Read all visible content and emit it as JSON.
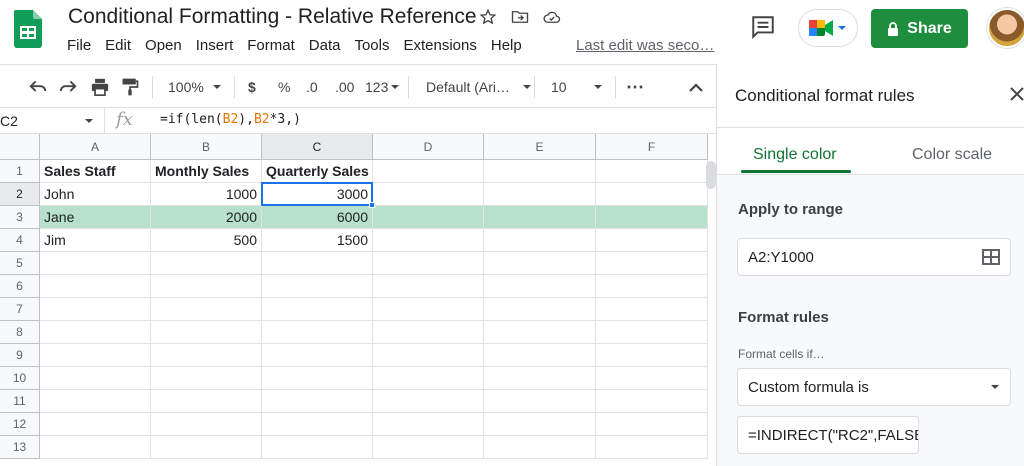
{
  "header": {
    "title": "Conditional Formatting - Relative Reference",
    "menu": [
      "File",
      "Edit",
      "Open",
      "Insert",
      "Format",
      "Data",
      "Tools",
      "Extensions",
      "Help"
    ],
    "last_edit": "Last edit was seco…",
    "share_label": "Share"
  },
  "toolbar": {
    "zoom": "100%",
    "currency": "$",
    "percent": "%",
    "dec_decrease": ".0",
    "dec_increase": ".00",
    "more_formats": "123",
    "font": "Default (Ari…",
    "font_size": "10",
    "more": "⋯"
  },
  "formula_bar": {
    "cell_ref": "C2",
    "fx": "fx",
    "formula_parts": [
      "=if(len(",
      "B2",
      "),",
      "B2",
      "*3,)"
    ]
  },
  "grid": {
    "columns": [
      "A",
      "B",
      "C",
      "D",
      "E",
      "F"
    ],
    "rows": [
      "1",
      "2",
      "3",
      "4",
      "5",
      "6",
      "7",
      "8",
      "9",
      "10",
      "11",
      "12",
      "13"
    ],
    "cells": [
      [
        "Sales Staff",
        "Monthly Sales",
        "Quarterly Sales",
        "",
        "",
        ""
      ],
      [
        "John",
        "1000",
        "3000",
        "",
        "",
        ""
      ],
      [
        "Jane",
        "2000",
        "6000",
        "",
        "",
        ""
      ],
      [
        "Jim",
        "500",
        "1500",
        "",
        "",
        ""
      ]
    ],
    "highlight_color": "#b7e1cd",
    "selection_color": "#1a73e8"
  },
  "panel": {
    "title": "Conditional format rules",
    "tab_single": "Single color",
    "tab_scale": "Color scale",
    "apply_label": "Apply to range",
    "range_value": "A2:Y1000",
    "rules_label": "Format rules",
    "format_cells_label": "Format cells if…",
    "condition": "Custom formula is",
    "formula_value": "=INDIRECT(\"RC2\",FALSE"
  },
  "colors": {
    "accent_green": "#1e8e3e",
    "tab_green": "#137333",
    "formula_ref_orange": "#e37400"
  }
}
